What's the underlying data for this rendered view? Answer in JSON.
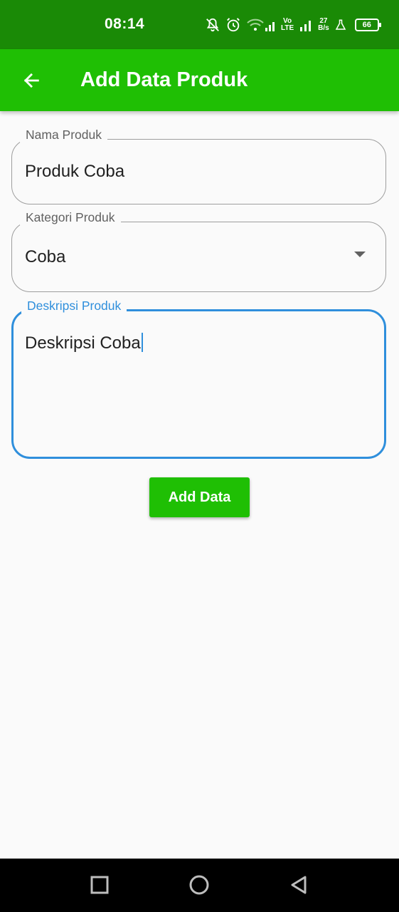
{
  "status_bar": {
    "time": "08:14",
    "lte_top": "Vo",
    "lte_bottom": "LTE",
    "speed_value": "27",
    "speed_unit": "B/s",
    "battery": "66"
  },
  "app_bar": {
    "title": "Add Data Produk",
    "back_icon": "arrow-left-icon"
  },
  "form": {
    "nama_produk": {
      "label": "Nama Produk",
      "value": "Produk Coba"
    },
    "kategori_produk": {
      "label": "Kategori Produk",
      "value": "Coba"
    },
    "deskripsi_produk": {
      "label": "Deskripsi Produk",
      "value": "Deskripsi Coba"
    },
    "submit_label": "Add Data"
  },
  "colors": {
    "status_bar": "#1a8a06",
    "app_bar": "#1fbf04",
    "focus": "#2f8fdc"
  }
}
